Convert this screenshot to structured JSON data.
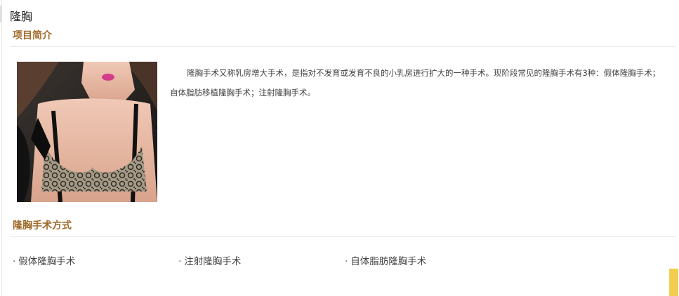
{
  "page": {
    "title": "隆胸"
  },
  "intro": {
    "heading": "项目简介",
    "text": "隆胸手术又称乳房增大手术，是指对不发育或发育不良的小乳房进行扩大的一种手术。现阶段常见的隆胸手术有3种：假体隆胸手术；自体脂肪移植隆胸手术；注射隆胸手术。"
  },
  "methods": {
    "heading": "隆胸手术方式",
    "bullet": "·",
    "items": [
      {
        "label": "假体隆胸手术"
      },
      {
        "label": "注射隆胸手术"
      },
      {
        "label": "自体脂肪隆胸手术"
      }
    ]
  },
  "colors": {
    "heading": "#a06b2a",
    "accent": "#f2cd4e"
  }
}
